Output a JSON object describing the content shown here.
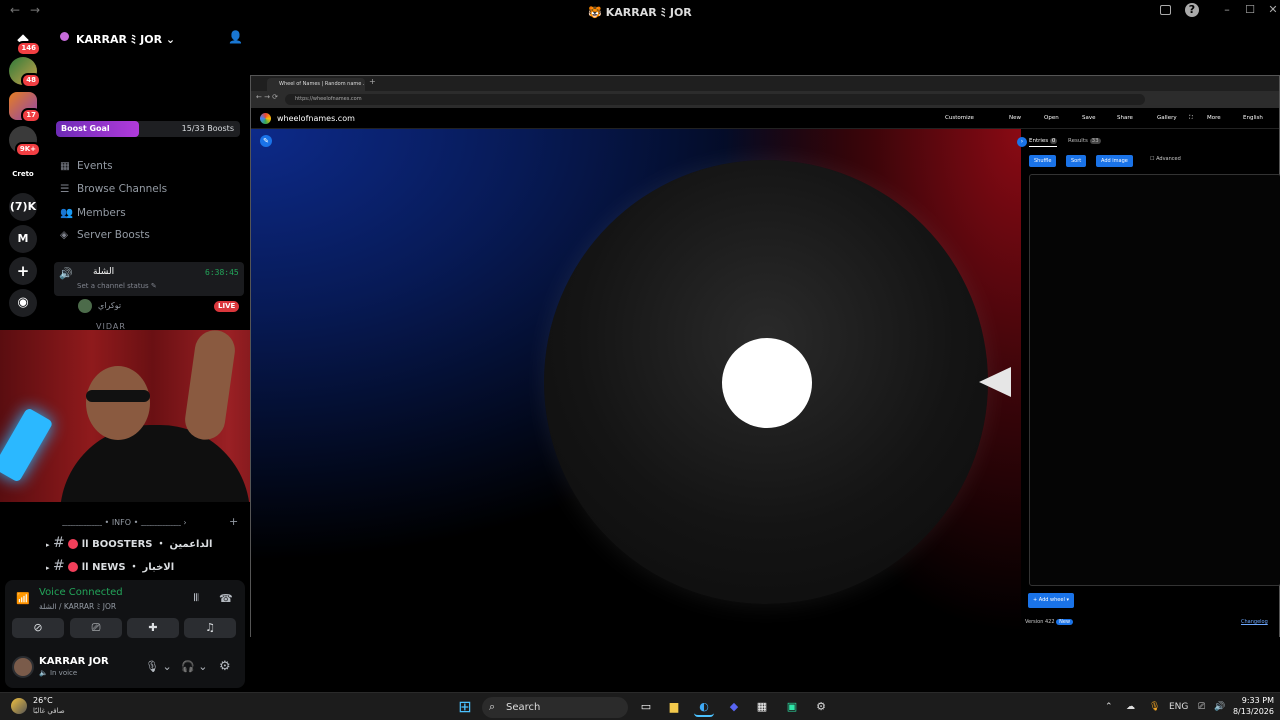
{
  "titlebar": {
    "back": "←",
    "forward": "→",
    "title": "🐯 KARRAR ﾐ JOR"
  },
  "rail": {
    "items": [
      {
        "name": "discord-home",
        "glyph": "◆",
        "badge": "146"
      },
      {
        "name": "server-1",
        "glyph": "",
        "badge": "48"
      },
      {
        "name": "server-2",
        "glyph": "",
        "badge": "17"
      },
      {
        "name": "server-3",
        "glyph": "",
        "badge": "9K+"
      },
      {
        "name": "server-creto",
        "glyph": "Creto",
        "badge": ""
      },
      {
        "name": "server-7k",
        "glyph": "(7)K",
        "badge": ""
      },
      {
        "name": "server-m",
        "glyph": "M",
        "badge": ""
      },
      {
        "name": "add-server",
        "glyph": "+",
        "badge": ""
      },
      {
        "name": "discover",
        "glyph": "◉",
        "badge": ""
      }
    ]
  },
  "server": {
    "name": "KARRAR ﾐ JOR",
    "boost_label": "Boost Goal",
    "boost_count": "15/33 Boosts",
    "boost_fraction": 0.45,
    "nav": [
      "Events",
      "Browse Channels",
      "Members",
      "Server Boosts"
    ]
  },
  "voice_channel": {
    "name": "الشلة",
    "timer": "6:38:45",
    "status_prompt": "Set a channel status",
    "member1": "توكراي",
    "live": "LIVE",
    "member2": "VIDAR"
  },
  "channels": {
    "category": "INFO",
    "items": [
      {
        "label": "اا BOOSTERS ・ الداعمين"
      },
      {
        "label": "اا NEWS ・ الاخبار"
      }
    ]
  },
  "voice": {
    "connected": "Voice Connected",
    "location": "الشلة / KARRAR ﾐ JOR"
  },
  "user": {
    "name": "KARRAR JOR",
    "status": "In voice"
  },
  "browser": {
    "tab_title": "Wheel of Names | Random name ...",
    "url": "https://wheelofnames.com",
    "site": "wheelofnames.com",
    "menu": [
      "Customize",
      "New",
      "Open",
      "Save",
      "Share",
      "Gallery",
      "More",
      "English"
    ],
    "tabs": {
      "entries": "Entries",
      "entries_count": "0",
      "results": "Results",
      "results_count": "33"
    },
    "buttons": {
      "shuffle": "Shuffle",
      "sort": "Sort",
      "add_image": "Add image",
      "advanced": "Advanced",
      "add_wheel": "Add wheel"
    },
    "version": "Version 422",
    "version_badge": "New",
    "changelog": "Changelog"
  },
  "taskbar": {
    "weather_temp": "26°C",
    "weather_desc": "صافي غالبًا",
    "search": "Search",
    "lang": "ENG",
    "time": "9:33 PM",
    "date": "8/13/2026"
  }
}
